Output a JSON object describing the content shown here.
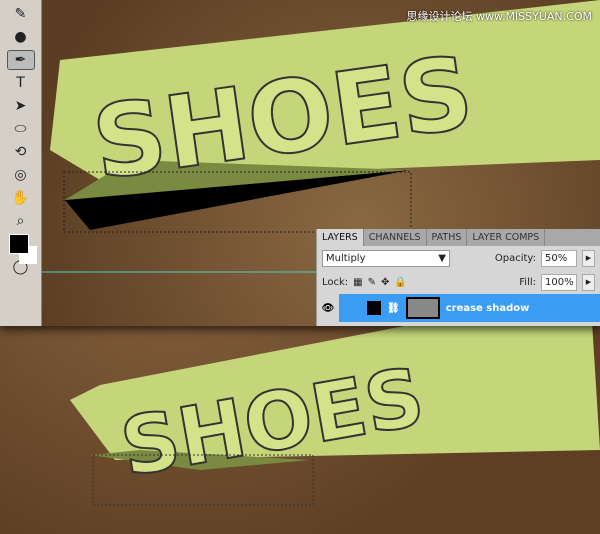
{
  "watermark": "思缘设计论坛 www.MISSYUAN.COM",
  "artwork_text": "SHOES",
  "tools": [
    {
      "icon": "brush-tool-icon",
      "glyph": "✎"
    },
    {
      "icon": "burn-tool-icon",
      "glyph": "●"
    },
    {
      "icon": "pen-tool-icon",
      "glyph": "✒"
    },
    {
      "icon": "type-tool-icon",
      "glyph": "T"
    },
    {
      "icon": "path-selection-icon",
      "glyph": "➤"
    },
    {
      "icon": "ellipse-tool-icon",
      "glyph": "⬭"
    },
    {
      "icon": "3d-rotate-icon",
      "glyph": "⟲"
    },
    {
      "icon": "3d-orbit-icon",
      "glyph": "◎"
    },
    {
      "icon": "hand-tool-icon",
      "glyph": "✋"
    },
    {
      "icon": "zoom-tool-icon",
      "glyph": "⌕"
    }
  ],
  "colors": {
    "foreground": "#000000",
    "background": "#ffffff",
    "selection": "#3b9cf4"
  },
  "layers_panel": {
    "tabs": [
      "LAYERS",
      "CHANNELS",
      "PATHS",
      "LAYER COMPS"
    ],
    "active_tab": "LAYERS",
    "blend_mode": "Multiply",
    "opacity_label": "Opacity:",
    "opacity": "50%",
    "lock_label": "Lock:",
    "fill_label": "Fill:",
    "fill": "100%",
    "layer": {
      "name": "crease shadow",
      "visible": true
    }
  }
}
